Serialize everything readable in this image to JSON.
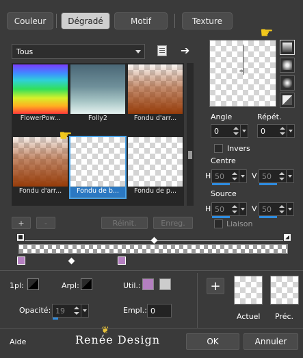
{
  "tabs": [
    {
      "label": "Couleur",
      "active": false
    },
    {
      "label": "Dégradé",
      "active": true
    },
    {
      "label": "Motif",
      "active": false
    },
    {
      "label": "Texture",
      "active": false
    }
  ],
  "category": {
    "selected": "Tous"
  },
  "gradients": [
    {
      "name": "FlowerPow..."
    },
    {
      "name": "Folly2"
    },
    {
      "name": "Fondu d'arr..."
    },
    {
      "name": "Fondu d'arr..."
    },
    {
      "name": "Fondu de b...",
      "selected": true
    },
    {
      "name": "Fondu de p..."
    }
  ],
  "library_buttons": {
    "add": "+",
    "remove": "-",
    "reset": "Réinit.",
    "save": "Enreg."
  },
  "settings": {
    "angle_label": "Angle",
    "angle_value": "0",
    "repeat_label": "Répét.",
    "repeat_value": "0",
    "invert_label": "Invers",
    "center_label": "Centre",
    "center_h_label": "H",
    "center_h_value": "50",
    "center_v_label": "V",
    "center_v_value": "50",
    "source_label": "Source",
    "source_h_label": "H",
    "source_h_value": "50",
    "source_v_label": "V",
    "source_v_value": "50",
    "link_label": "Liaison"
  },
  "stops": {
    "pl_label": "1pl:",
    "arpl_label": "Arpl:",
    "util_label": "Util.:",
    "opacity_label": "Opacité:",
    "opacity_value": "19",
    "opacity_percent": 19,
    "empl_label": "Empl.:",
    "empl_value": "0",
    "util_color": "#b47fc0"
  },
  "compare": {
    "add": "+",
    "current_label": "Actuel",
    "previous_label": "Préc."
  },
  "footer": {
    "help": "Aide",
    "logo": "Renée Design",
    "ok": "OK",
    "cancel": "Annuler"
  }
}
